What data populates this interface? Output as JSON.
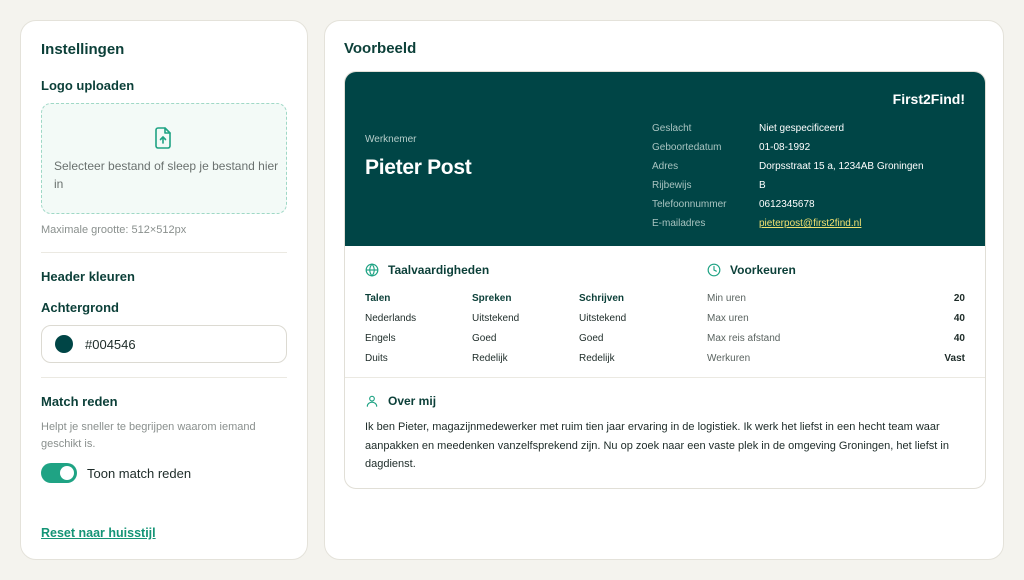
{
  "settings": {
    "title": "Instellingen",
    "logo": {
      "label": "Logo uploaden",
      "dropzone_text": "Selecteer bestand of sleep je bestand hier in",
      "hint": "Maximale grootte: 512×512px"
    },
    "header_colors": {
      "title": "Header kleuren",
      "background_label": "Achtergrond",
      "background_value": "#004546"
    },
    "match_reason": {
      "title": "Match reden",
      "description": "Helpt je sneller te begrijpen waarom iemand geschikt is.",
      "toggle_label": "Toon match reden",
      "toggle_on": true
    },
    "reset_label": "Reset naar huisstijl"
  },
  "preview": {
    "title": "Voorbeeld",
    "card": {
      "brand": "First2Find!",
      "role": "Werknemer",
      "name": "Pieter Post",
      "facts": [
        {
          "label": "Geslacht",
          "value": "Niet gespecificeerd"
        },
        {
          "label": "Geboortedatum",
          "value": "01-08-1992"
        },
        {
          "label": "Adres",
          "value": "Dorpsstraat 15 a, 1234AB Groningen"
        },
        {
          "label": "Rijbewijs",
          "value": "B"
        },
        {
          "label": "Telefoonnummer",
          "value": "0612345678"
        },
        {
          "label": "E-mailadres",
          "value": "pieterpost@first2find.nl"
        }
      ],
      "languages": {
        "title": "Taalvaardigheden",
        "headers": [
          "Talen",
          "Spreken",
          "Schrijven"
        ],
        "rows": [
          [
            "Nederlands",
            "Uitstekend",
            "Uitstekend"
          ],
          [
            "Engels",
            "Goed",
            "Goed"
          ],
          [
            "Duits",
            "Redelijk",
            "Redelijk"
          ]
        ]
      },
      "preferences": {
        "title": "Voorkeuren",
        "rows": [
          {
            "label": "Min uren",
            "value": "20"
          },
          {
            "label": "Max uren",
            "value": "40"
          },
          {
            "label": "Max reis afstand",
            "value": "40"
          },
          {
            "label": "Werkuren",
            "value": "Vast"
          }
        ]
      },
      "about": {
        "title": "Over mij",
        "text": "Ik ben Pieter, magazijnmedewerker met ruim tien jaar ervaring in de logistiek. Ik werk het liefst in een hecht team waar aanpakken en meedenken vanzelfsprekend zijn. Nu op zoek naar een vaste plek in de omgeving Groningen, het liefst in dagdienst."
      }
    }
  },
  "colors": {
    "header_bg": "#004546",
    "accent": "#1fa384",
    "page_bg": "#f4f3ee"
  },
  "icons": {
    "upload": "file-upload-icon",
    "languages": "globe-icon",
    "preferences": "clock-icon",
    "about": "user-icon"
  }
}
